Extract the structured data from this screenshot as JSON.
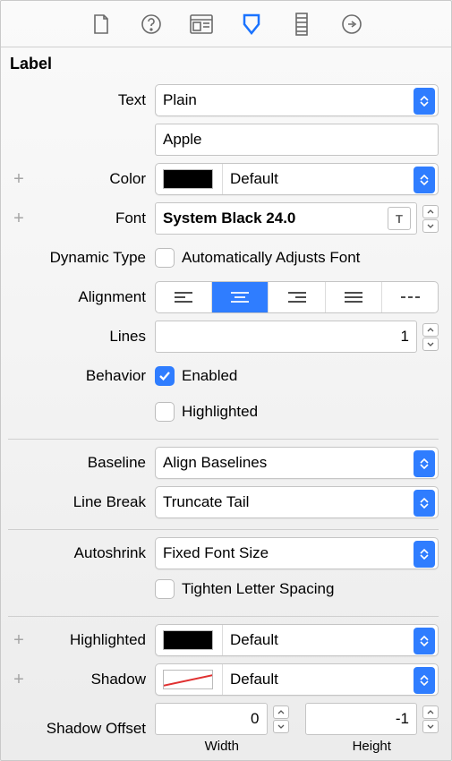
{
  "section_header": "Label",
  "labels": {
    "text": "Text",
    "color": "Color",
    "font": "Font",
    "dynamic_type": "Dynamic Type",
    "alignment": "Alignment",
    "lines": "Lines",
    "behavior": "Behavior",
    "baseline": "Baseline",
    "line_break": "Line Break",
    "autoshrink": "Autoshrink",
    "highlighted": "Highlighted",
    "shadow": "Shadow",
    "shadow_offset": "Shadow Offset"
  },
  "values": {
    "text_mode": "Plain",
    "text_content": "Apple",
    "color": "Default",
    "font": "System Black 24.0",
    "dynamic_type_checkbox": "Automatically Adjusts Font",
    "lines": "1",
    "behavior_enabled": "Enabled",
    "behavior_highlighted": "Highlighted",
    "baseline": "Align Baselines",
    "line_break": "Truncate Tail",
    "autoshrink": "Fixed Font Size",
    "tighten_spacing": "Tighten Letter Spacing",
    "highlighted_color": "Default",
    "shadow_color": "Default",
    "shadow_offset_width": "0",
    "shadow_offset_height": "-1",
    "offset_width_label": "Width",
    "offset_height_label": "Height"
  },
  "colors": {
    "accent": "#2f7dff",
    "swatch_text": "#000000"
  }
}
